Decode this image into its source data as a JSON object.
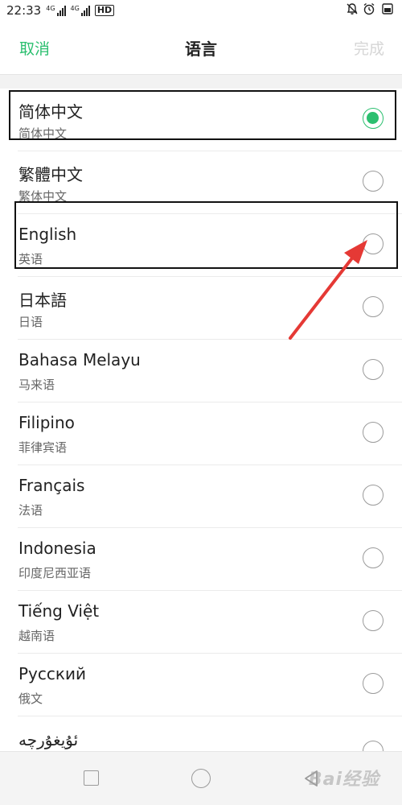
{
  "status_bar": {
    "time": "22:33",
    "signal1_label": "4G",
    "signal2_label": "4G",
    "hd_label": "HD"
  },
  "header": {
    "cancel_label": "取消",
    "title": "语言",
    "done_label": "完成"
  },
  "languages": [
    {
      "name": "简体中文",
      "native": "简体中文",
      "selected": true
    },
    {
      "name": "繁體中文",
      "native": "繁体中文",
      "selected": false
    },
    {
      "name": "English",
      "native": "英语",
      "selected": false
    },
    {
      "name": "日本語",
      "native": "日语",
      "selected": false
    },
    {
      "name": "Bahasa Melayu",
      "native": "马来语",
      "selected": false
    },
    {
      "name": "Filipino",
      "native": "菲律宾语",
      "selected": false
    },
    {
      "name": "Français",
      "native": "法语",
      "selected": false
    },
    {
      "name": "Indonesia",
      "native": "印度尼西亚语",
      "selected": false
    },
    {
      "name": "Tiếng Việt",
      "native": "越南语",
      "selected": false
    },
    {
      "name": "Русский",
      "native": "俄文",
      "selected": false
    },
    {
      "name": "ئۇيغۇرچە",
      "native": "",
      "selected": false
    }
  ],
  "colors": {
    "accent": "#2bbf6f",
    "annotation_arrow": "#e53935",
    "disabled_text": "#d6d6d6"
  },
  "watermark": "Bai经验"
}
